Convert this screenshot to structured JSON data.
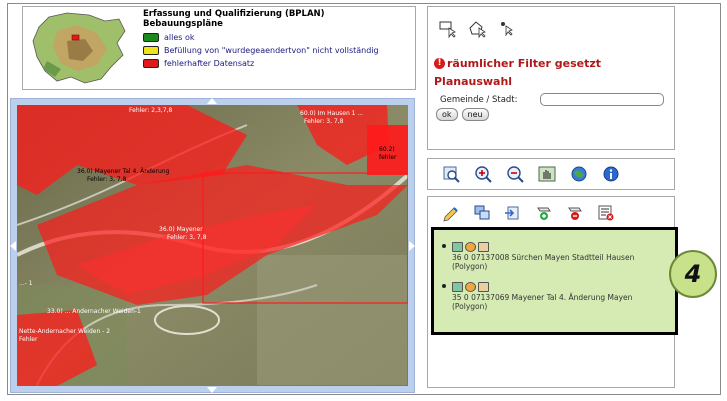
{
  "legend": {
    "title": "Erfassung und Qualifizierung (BPLAN)",
    "subtitle": "Bebauungspläne",
    "items": [
      {
        "label": "alles ok",
        "color": "#1a8a1a"
      },
      {
        "label": "Befüllung von \"wurdegeaendertvon\" nicht vollständig",
        "color": "#f2e21a"
      },
      {
        "label": "fehlerhafter Datensatz",
        "color": "#e01a1a"
      }
    ]
  },
  "filter": {
    "warning": "räumlicher Filter gesetzt",
    "heading": "Planauswahl",
    "city_label": "Gemeinde / Stadt:",
    "city_value": "",
    "ok_label": "ok",
    "new_label": "neu"
  },
  "map": {
    "labels": [
      "Fehler: 2,3,7,8",
      "60.0) Im Hausen 1 ...",
      "Fehler: 3, 7,8",
      "36.0) Mayener Tal 4. Änderung",
      "Fehler: 3, 7,8",
      "36.0) Mayener",
      "Fehler: 3, 7,8",
      "60.2)",
      "fehler",
      "33.0) ... Andernacher Weiden-1",
      "Nette-Andernacher Weiden - 2",
      "Fehler",
      "...- 1"
    ]
  },
  "results": {
    "items": [
      {
        "line1": "36 0 07137008 Sürchen Mayen Stadtteil Hausen",
        "line2": "(Polygon)"
      },
      {
        "line1": "35 0 07137069 Mayener Tal 4. Änderung Mayen",
        "line2": "(Polygon)"
      }
    ]
  },
  "badge": {
    "label": "4"
  },
  "colors": {
    "accent_red": "#b01818",
    "result_bg": "#d6ebb4",
    "badge_bg": "#c7e28a"
  }
}
